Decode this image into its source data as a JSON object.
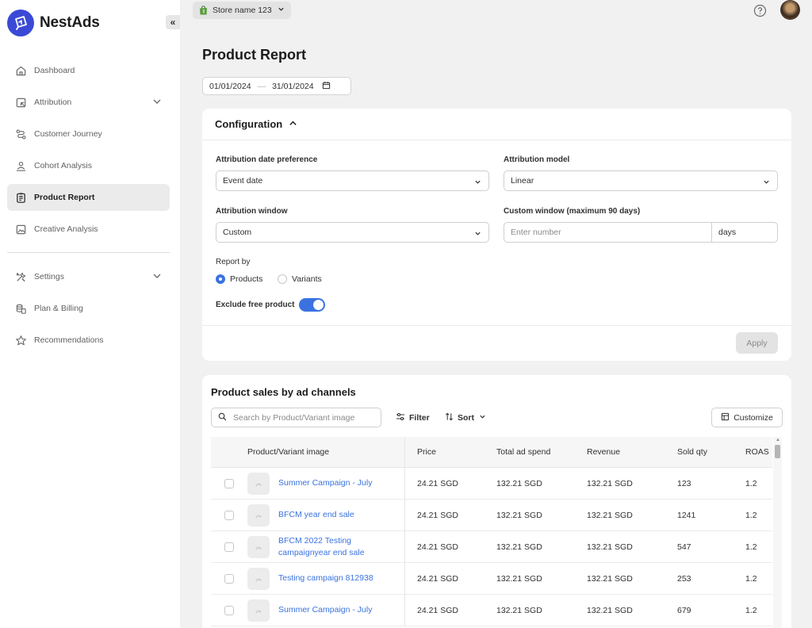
{
  "app": {
    "name": "NestAds"
  },
  "sidebar": {
    "items": [
      {
        "key": "dashboard",
        "label": "Dashboard",
        "icon": "home-icon"
      },
      {
        "key": "attribution",
        "label": "Attribution",
        "icon": "attribution-icon",
        "expandable": true
      },
      {
        "key": "customer-journey",
        "label": "Customer Journey",
        "icon": "journey-icon"
      },
      {
        "key": "cohort-analysis",
        "label": "Cohort Analysis",
        "icon": "cohort-icon"
      },
      {
        "key": "product-report",
        "label": "Product Report",
        "icon": "report-icon",
        "active": true
      },
      {
        "key": "creative-analysis",
        "label": "Creative Analysis",
        "icon": "image-icon"
      }
    ],
    "secondary": [
      {
        "key": "settings",
        "label": "Settings",
        "icon": "tools-icon",
        "expandable": true
      },
      {
        "key": "plan-billing",
        "label": "Plan & Billing",
        "icon": "billing-icon"
      },
      {
        "key": "recommendations",
        "label": "Recommendations",
        "icon": "star-icon"
      }
    ]
  },
  "topbar": {
    "store_name": "Store name 123"
  },
  "page": {
    "title": "Product Report",
    "date_start": "01/01/2024",
    "date_separator": "—",
    "date_end": "31/01/2024"
  },
  "config": {
    "title": "Configuration",
    "date_pref_label": "Attribution date preference",
    "date_pref_value": "Event date",
    "model_label": "Attribution model",
    "model_value": "Linear",
    "window_label": "Attribution window",
    "window_value": "Custom",
    "custom_window_label": "Custom window (maximum 90 days)",
    "custom_window_placeholder": "Enter number",
    "custom_window_suffix": "days",
    "report_by_label": "Report by",
    "report_by_options": [
      "Products",
      "Variants"
    ],
    "report_by_selected": "Products",
    "exclude_free_label": "Exclude free product",
    "exclude_free_on": true,
    "apply_label": "Apply"
  },
  "sales": {
    "title": "Product sales by ad channels",
    "search_placeholder": "Search by Product/Variant image",
    "filter_label": "Filter",
    "sort_label": "Sort",
    "customize_label": "Customize",
    "columns": [
      "Product/Variant image",
      "Price",
      "Total ad spend",
      "Revenue",
      "Sold qty",
      "ROAS"
    ],
    "rows": [
      {
        "name": "Summer Campaign - July",
        "price": "24.21 SGD",
        "spend": "132.21 SGD",
        "revenue": "132.21 SGD",
        "qty": "123",
        "roas": "1.2"
      },
      {
        "name": "BFCM year end sale",
        "price": "24.21 SGD",
        "spend": "132.21 SGD",
        "revenue": "132.21 SGD",
        "qty": "1241",
        "roas": "1.2"
      },
      {
        "name": "BFCM 2022 Testing campaignyear end sale",
        "price": "24.21 SGD",
        "spend": "132.21 SGD",
        "revenue": "132.21 SGD",
        "qty": "547",
        "roas": "1.2"
      },
      {
        "name": "Testing campaign 812938",
        "price": "24.21 SGD",
        "spend": "132.21 SGD",
        "revenue": "132.21 SGD",
        "qty": "253",
        "roas": "1.2"
      },
      {
        "name": "Summer Campaign - July",
        "price": "24.21 SGD",
        "spend": "132.21 SGD",
        "revenue": "132.21 SGD",
        "qty": "679",
        "roas": "1.2"
      }
    ]
  },
  "colors": {
    "accent": "#3a72e0",
    "brand": "#3a4ad6",
    "link": "#3a72e0"
  }
}
